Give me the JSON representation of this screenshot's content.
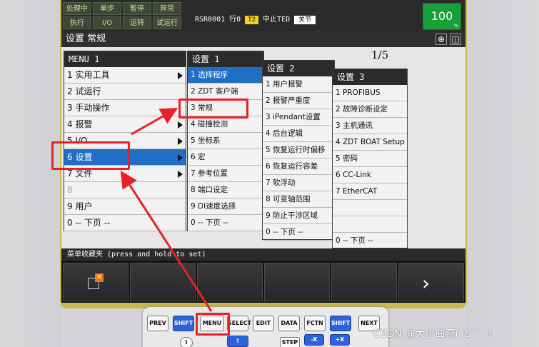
{
  "status": {
    "buttons": [
      "处理中",
      "单步",
      "暂停",
      "异常",
      "执行",
      "I/O",
      "运转",
      "试运行"
    ],
    "program": "RSR0001",
    "line": "行0",
    "mode": "T2",
    "state": "中止TED",
    "joint": "关节",
    "override": "100",
    "override_unit": "%"
  },
  "title": "设置 常规",
  "page_indicator": "1/5",
  "menu1": {
    "header": "MENU  1",
    "items": [
      "1 实用工具",
      "2 试运行",
      "3 手动操作",
      "4 报警",
      "5 I/O",
      "6 设置",
      "7 文件",
      "8",
      "9 用户",
      "0 -- 下页 --"
    ]
  },
  "menu2": {
    "header": "设置  1",
    "items": [
      "1 选择程序",
      "2 ZDT 客户端",
      "3 常规",
      "4 碰撞检测",
      "5 坐标系",
      "6 宏",
      "7 参考位置",
      "8 端口设定",
      "9 DI速度选择",
      "0 -- 下页 --"
    ]
  },
  "menu3": {
    "header": "设置  2",
    "items": [
      "1 用户报警",
      "2 报警严重度",
      "3 iPendant设置",
      "4 后台逻辑",
      "5 恢复运行时偏移",
      "6 恢复运行容差",
      "7 软浮动",
      "8 可变轴范围",
      "9 防止干涉区域",
      "0 -- 下页 --"
    ]
  },
  "menu4": {
    "header": "设置  3",
    "items": [
      "1 PROFIBUS",
      "2 故障诊断设定",
      "3 主机通讯",
      "4 ZDT BOAT Setup",
      "5 密码",
      "6 CC-Link",
      "7 EtherCAT",
      "",
      "",
      "0 -- 下页 --"
    ]
  },
  "hint": "菜单收藏夹 (press and hold to set)",
  "keypad": {
    "row1": [
      "PREV",
      "SHIFT",
      "MENU",
      "SELECT",
      "EDIT",
      "DATA",
      "FCTN",
      "SHIFT",
      "NEXT"
    ],
    "row2": [
      "i",
      "",
      "STEP",
      "-X",
      "+X"
    ]
  },
  "watermark": "CSDN @大小曲奇(ˇε ˇ　)",
  "colors": {
    "selection": "#1f6fc6",
    "annotation": "#e8202a",
    "override_bg": "#18a038",
    "mode_tag": "#f5d21a"
  }
}
